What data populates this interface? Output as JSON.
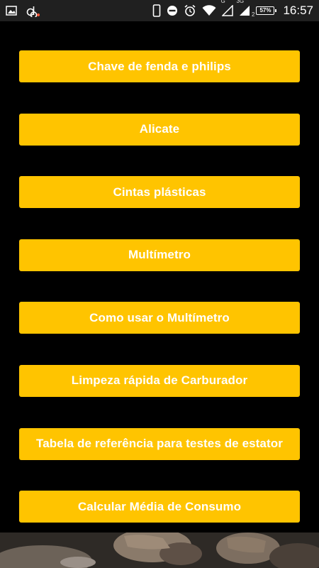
{
  "status_bar": {
    "time": "16:57",
    "battery": "57%",
    "network_g": "G",
    "network_3g": "3G",
    "sim_label": "2",
    "icons": {
      "left": [
        "image-icon",
        "notification-app-icon"
      ],
      "right": [
        "phone-vibrate-icon",
        "do-not-disturb-icon",
        "alarm-icon",
        "wifi-icon",
        "signal-g-icon",
        "signal-3g-icon",
        "battery-icon"
      ]
    }
  },
  "menu": {
    "items": [
      {
        "label": "Chave de fenda e philips"
      },
      {
        "label": "Alicate"
      },
      {
        "label": "Cintas plásticas"
      },
      {
        "label": "Multímetro"
      },
      {
        "label": "Como usar o Multímetro"
      },
      {
        "label": "Limpeza rápida de Carburador"
      },
      {
        "label": "Tabela de referência para testes de estator"
      },
      {
        "label": "Calcular Média de Consumo"
      }
    ]
  },
  "colors": {
    "background": "#000000",
    "button": "#ffc400",
    "button_text": "#ffffff",
    "status_bar": "#202020"
  }
}
